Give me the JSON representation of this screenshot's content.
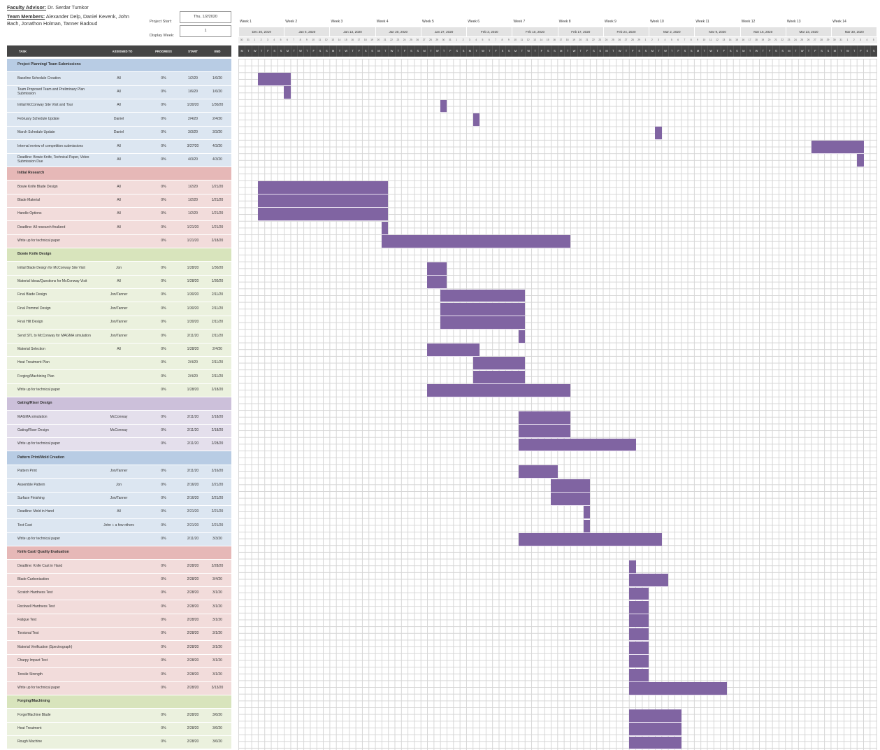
{
  "header": {
    "advisor_label": "Faculty Advisor:",
    "advisor_name": " Dr. Serdar Tumkor",
    "members_label": "Team Members:",
    "members_line1": " Alexander Delp, Daniel Kevenk, John",
    "members_line2": "Bach, Jonathon Holman, Tanner Badoud",
    "project_start_label": "Project Start:",
    "project_start_value": "Thu, 1/2/2020",
    "display_week_label": "Display Week:",
    "display_week_value": "1"
  },
  "columns": {
    "task": "TASK",
    "assigned": "ASSIGNED TO",
    "progress": "PROGRESS",
    "start": "START",
    "end": "END"
  },
  "timeline": {
    "weeks": [
      "Week 1",
      "Week 2",
      "Week 3",
      "Week 4",
      "Week 5",
      "Week 6",
      "Week 7",
      "Week 8",
      "Week 9",
      "Week 10",
      "Week 11",
      "Week 12",
      "Week 13",
      "Week 14"
    ],
    "week_dates": [
      "Dec 30, 2019",
      "Jan 6, 2020",
      "Jan 13, 2020",
      "Jan 20, 2020",
      "Jan 27, 2020",
      "Feb 3, 2020",
      "Feb 10, 2020",
      "Feb 17, 2020",
      "Feb 24, 2020",
      "Mar 2, 2020",
      "Mar 9, 2020",
      "Mar 16, 2020",
      "Mar 23, 2020",
      "Mar 30, 2020"
    ],
    "day_numbers": [
      "30",
      "31",
      "1",
      "2",
      "3",
      "4",
      "5",
      "6",
      "7",
      "8",
      "9",
      "10",
      "11",
      "12",
      "13",
      "14",
      "15",
      "16",
      "17",
      "18",
      "19",
      "20",
      "21",
      "22",
      "23",
      "24",
      "25",
      "26",
      "27",
      "28",
      "29",
      "30",
      "31",
      "1",
      "2",
      "3",
      "4",
      "5",
      "6",
      "7",
      "8",
      "9",
      "10",
      "11",
      "12",
      "13",
      "14",
      "15",
      "16",
      "17",
      "18",
      "19",
      "20",
      "21",
      "22",
      "23",
      "24",
      "25",
      "26",
      "27",
      "28",
      "29",
      "1",
      "2",
      "3",
      "4",
      "5",
      "6",
      "7",
      "8",
      "9",
      "10",
      "11",
      "12",
      "13",
      "14",
      "15",
      "16",
      "17",
      "18",
      "19",
      "20",
      "21",
      "22",
      "23",
      "24",
      "25",
      "26",
      "27",
      "28",
      "29",
      "30",
      "31",
      "1",
      "2",
      "3",
      "4",
      "5"
    ],
    "day_letters": [
      "M",
      "T",
      "W",
      "T",
      "F",
      "S",
      "S"
    ]
  },
  "colors": {
    "bar": "#8064a2",
    "blue": "#dce6f1",
    "red": "#f2dcdb",
    "green": "#ebf1de",
    "purple": "#e4dfec",
    "blue_head": "#b8cce4",
    "red_head": "#e6b8b7",
    "green_head": "#d8e4bc",
    "purple_head": "#ccc0da"
  },
  "rows": [
    {
      "type": "section",
      "name": "Project Planning/ Team Submissions",
      "color": "blue"
    },
    {
      "type": "task",
      "name": "Baseline Schedule Creation",
      "assigned": "All",
      "progress": "0%",
      "start": "1/2/20",
      "end": "1/6/20",
      "color": "blue",
      "bar_day_start": 3,
      "bar_day_end": 7
    },
    {
      "type": "task",
      "name": "Team Proposed Team and Preliminary Plan Submission",
      "assigned": "All",
      "progress": "0%",
      "start": "1/6/20",
      "end": "1/6/20",
      "color": "blue",
      "bar_day_start": 7,
      "bar_day_end": 7
    },
    {
      "type": "task",
      "name": "Initial McConway Site Visit and Tour",
      "assigned": "All",
      "progress": "0%",
      "start": "1/30/20",
      "end": "1/30/20",
      "color": "blue",
      "bar_day_start": 31,
      "bar_day_end": 31
    },
    {
      "type": "task",
      "name": "February Schedule Update",
      "assigned": "Daniel",
      "progress": "0%",
      "start": "2/4/20",
      "end": "2/4/20",
      "color": "blue",
      "bar_day_start": 36,
      "bar_day_end": 36
    },
    {
      "type": "task",
      "name": "March Schedule Update",
      "assigned": "Daniel",
      "progress": "0%",
      "start": "3/3/20",
      "end": "3/3/20",
      "color": "blue",
      "bar_day_start": 64,
      "bar_day_end": 64
    },
    {
      "type": "task",
      "name": "Internal review of competition submissions",
      "assigned": "All",
      "progress": "0%",
      "start": "3/27/20",
      "end": "4/3/20",
      "color": "blue",
      "bar_day_start": 88,
      "bar_day_end": 95
    },
    {
      "type": "task",
      "name": "Deadline: Bowie Knife, Technical Paper, Video Submission Due",
      "assigned": "All",
      "progress": "0%",
      "start": "4/3/20",
      "end": "4/3/20",
      "color": "blue",
      "bar_day_start": 95,
      "bar_day_end": 95
    },
    {
      "type": "section",
      "name": "Initial Research",
      "color": "red"
    },
    {
      "type": "task",
      "name": "Bowie Knife Blade Design",
      "assigned": "All",
      "progress": "0%",
      "start": "1/2/20",
      "end": "1/21/20",
      "color": "red",
      "bar_day_start": 3,
      "bar_day_end": 22
    },
    {
      "type": "task",
      "name": "Blade Material",
      "assigned": "All",
      "progress": "0%",
      "start": "1/2/20",
      "end": "1/21/20",
      "color": "red",
      "bar_day_start": 3,
      "bar_day_end": 22
    },
    {
      "type": "task",
      "name": "Handle Options",
      "assigned": "All",
      "progress": "0%",
      "start": "1/2/20",
      "end": "1/21/20",
      "color": "red",
      "bar_day_start": 3,
      "bar_day_end": 22
    },
    {
      "type": "task",
      "name": "Deadline: All research finalized",
      "assigned": "All",
      "progress": "0%",
      "start": "1/21/20",
      "end": "1/21/20",
      "color": "red",
      "bar_day_start": 22,
      "bar_day_end": 22
    },
    {
      "type": "task",
      "name": "Write up for technical paper",
      "assigned": "",
      "progress": "0%",
      "start": "1/21/20",
      "end": "2/18/20",
      "color": "red",
      "bar_day_start": 22,
      "bar_day_end": 50
    },
    {
      "type": "section",
      "name": "Bowie Knife Design",
      "color": "green"
    },
    {
      "type": "task",
      "name": "Initial Blade Design for McConway Site Visit",
      "assigned": "Jon",
      "progress": "0%",
      "start": "1/28/20",
      "end": "1/30/20",
      "color": "green",
      "bar_day_start": 29,
      "bar_day_end": 31
    },
    {
      "type": "task",
      "name": "Material Ideas/Questions for McConway Visit",
      "assigned": "All",
      "progress": "0%",
      "start": "1/28/20",
      "end": "1/30/20",
      "color": "green",
      "bar_day_start": 29,
      "bar_day_end": 31
    },
    {
      "type": "task",
      "name": "Final Blade Design",
      "assigned": "Jon/Tanner",
      "progress": "0%",
      "start": "1/30/20",
      "end": "2/11/20",
      "color": "green",
      "bar_day_start": 31,
      "bar_day_end": 43
    },
    {
      "type": "task",
      "name": "Final Pommel Design",
      "assigned": "Jon/Tanner",
      "progress": "0%",
      "start": "1/30/20",
      "end": "2/11/20",
      "color": "green",
      "bar_day_start": 31,
      "bar_day_end": 43
    },
    {
      "type": "task",
      "name": "Final Hilt Design",
      "assigned": "Jon/Tanner",
      "progress": "0%",
      "start": "1/30/20",
      "end": "2/11/20",
      "color": "green",
      "bar_day_start": 31,
      "bar_day_end": 43
    },
    {
      "type": "task",
      "name": "Send STL to McConway for MAGMA simulation",
      "assigned": "Jon/Tanner",
      "progress": "0%",
      "start": "2/11/20",
      "end": "2/11/20",
      "color": "green",
      "bar_day_start": 43,
      "bar_day_end": 43
    },
    {
      "type": "task",
      "name": "Material Selection",
      "assigned": "All",
      "progress": "0%",
      "start": "1/28/20",
      "end": "2/4/20",
      "color": "green",
      "bar_day_start": 29,
      "bar_day_end": 36
    },
    {
      "type": "task",
      "name": "Heat Treatment Plan",
      "assigned": "",
      "progress": "0%",
      "start": "2/4/20",
      "end": "2/11/20",
      "color": "green",
      "bar_day_start": 36,
      "bar_day_end": 43
    },
    {
      "type": "task",
      "name": "Forging/Machining Plan",
      "assigned": "",
      "progress": "0%",
      "start": "2/4/20",
      "end": "2/11/20",
      "color": "green",
      "bar_day_start": 36,
      "bar_day_end": 43
    },
    {
      "type": "task",
      "name": "Write up for technical paper",
      "assigned": "",
      "progress": "0%",
      "start": "1/28/20",
      "end": "2/18/20",
      "color": "green",
      "bar_day_start": 29,
      "bar_day_end": 50
    },
    {
      "type": "section",
      "name": "Gating/Riser Design",
      "color": "purple"
    },
    {
      "type": "task",
      "name": "MAGMA simulation",
      "assigned": "McConway",
      "progress": "0%",
      "start": "2/11/20",
      "end": "2/18/20",
      "color": "purple",
      "bar_day_start": 43,
      "bar_day_end": 50
    },
    {
      "type": "task",
      "name": "Gating/Riser Design",
      "assigned": "McConway",
      "progress": "0%",
      "start": "2/11/20",
      "end": "2/18/20",
      "color": "purple",
      "bar_day_start": 43,
      "bar_day_end": 50
    },
    {
      "type": "task",
      "name": "Write up for technical paper",
      "assigned": "",
      "progress": "0%",
      "start": "2/11/20",
      "end": "2/28/20",
      "color": "purple",
      "bar_day_start": 43,
      "bar_day_end": 60
    },
    {
      "type": "section",
      "name": "Pattern Print/Mold Creation",
      "color": "blue"
    },
    {
      "type": "task",
      "name": "Pattern Print",
      "assigned": "Jon/Tanner",
      "progress": "0%",
      "start": "2/11/20",
      "end": "2/16/20",
      "color": "blue",
      "bar_day_start": 43,
      "bar_day_end": 48
    },
    {
      "type": "task",
      "name": "Assemble Pattern",
      "assigned": "Jon",
      "progress": "0%",
      "start": "2/16/20",
      "end": "2/21/20",
      "color": "blue",
      "bar_day_start": 48,
      "bar_day_end": 53
    },
    {
      "type": "task",
      "name": "Surface Finishing",
      "assigned": "Jon/Tanner",
      "progress": "0%",
      "start": "2/16/20",
      "end": "2/21/20",
      "color": "blue",
      "bar_day_start": 48,
      "bar_day_end": 53
    },
    {
      "type": "task",
      "name": "Deadline: Mold in Hand",
      "assigned": "All",
      "progress": "0%",
      "start": "2/21/20",
      "end": "2/21/20",
      "color": "blue",
      "bar_day_start": 53,
      "bar_day_end": 53
    },
    {
      "type": "task",
      "name": "Test Cast",
      "assigned": "John + a few others",
      "progress": "0%",
      "start": "2/21/20",
      "end": "2/21/20",
      "color": "blue",
      "bar_day_start": 53,
      "bar_day_end": 53
    },
    {
      "type": "task",
      "name": "Write up for technical paper",
      "assigned": "",
      "progress": "0%",
      "start": "2/11/20",
      "end": "3/3/20",
      "color": "blue",
      "bar_day_start": 43,
      "bar_day_end": 64
    },
    {
      "type": "section",
      "name": "Knife Cast/ Quality Evaluation",
      "color": "red"
    },
    {
      "type": "task",
      "name": "Deadline: Knife Cast in Hand",
      "assigned": "",
      "progress": "0%",
      "start": "2/28/20",
      "end": "2/28/20",
      "color": "red",
      "bar_day_start": 60,
      "bar_day_end": 60
    },
    {
      "type": "task",
      "name": "Blade Carbonization",
      "assigned": "",
      "progress": "0%",
      "start": "2/28/20",
      "end": "3/4/20",
      "color": "red",
      "bar_day_start": 60,
      "bar_day_end": 65
    },
    {
      "type": "task",
      "name": "Scratch Hardness Test",
      "assigned": "",
      "progress": "0%",
      "start": "2/28/20",
      "end": "3/1/20",
      "color": "red",
      "bar_day_start": 60,
      "bar_day_end": 62
    },
    {
      "type": "task",
      "name": "Rockwell Hardness Test",
      "assigned": "",
      "progress": "0%",
      "start": "2/28/20",
      "end": "3/1/20",
      "color": "red",
      "bar_day_start": 60,
      "bar_day_end": 62
    },
    {
      "type": "task",
      "name": "Fatigue Test",
      "assigned": "",
      "progress": "0%",
      "start": "2/28/20",
      "end": "3/1/20",
      "color": "red",
      "bar_day_start": 60,
      "bar_day_end": 62
    },
    {
      "type": "task",
      "name": "Torsional Test",
      "assigned": "",
      "progress": "0%",
      "start": "2/28/20",
      "end": "3/1/20",
      "color": "red",
      "bar_day_start": 60,
      "bar_day_end": 62
    },
    {
      "type": "task",
      "name": "Material Verification (Spectrograph)",
      "assigned": "",
      "progress": "0%",
      "start": "2/28/20",
      "end": "3/1/20",
      "color": "red",
      "bar_day_start": 60,
      "bar_day_end": 62
    },
    {
      "type": "task",
      "name": "Charpy Impact Test",
      "assigned": "",
      "progress": "0%",
      "start": "2/28/20",
      "end": "3/1/20",
      "color": "red",
      "bar_day_start": 60,
      "bar_day_end": 62
    },
    {
      "type": "task",
      "name": "Tensile Strength",
      "assigned": "",
      "progress": "0%",
      "start": "2/28/20",
      "end": "3/1/20",
      "color": "red",
      "bar_day_start": 60,
      "bar_day_end": 62
    },
    {
      "type": "task",
      "name": "Write up for technical paper",
      "assigned": "",
      "progress": "0%",
      "start": "2/28/20",
      "end": "3/13/20",
      "color": "red",
      "bar_day_start": 60,
      "bar_day_end": 74
    },
    {
      "type": "section",
      "name": "Forging/Machining",
      "color": "green"
    },
    {
      "type": "task",
      "name": "Forge/Machine Blade",
      "assigned": "",
      "progress": "0%",
      "start": "2/28/20",
      "end": "3/6/20",
      "color": "green",
      "bar_day_start": 60,
      "bar_day_end": 67
    },
    {
      "type": "task",
      "name": "Heat Treatment",
      "assigned": "",
      "progress": "0%",
      "start": "2/28/20",
      "end": "3/6/20",
      "color": "green",
      "bar_day_start": 60,
      "bar_day_end": 67
    },
    {
      "type": "task",
      "name": "Rough Machine",
      "assigned": "",
      "progress": "0%",
      "start": "2/28/20",
      "end": "3/6/20",
      "color": "green",
      "bar_day_start": 60,
      "bar_day_end": 67
    }
  ]
}
